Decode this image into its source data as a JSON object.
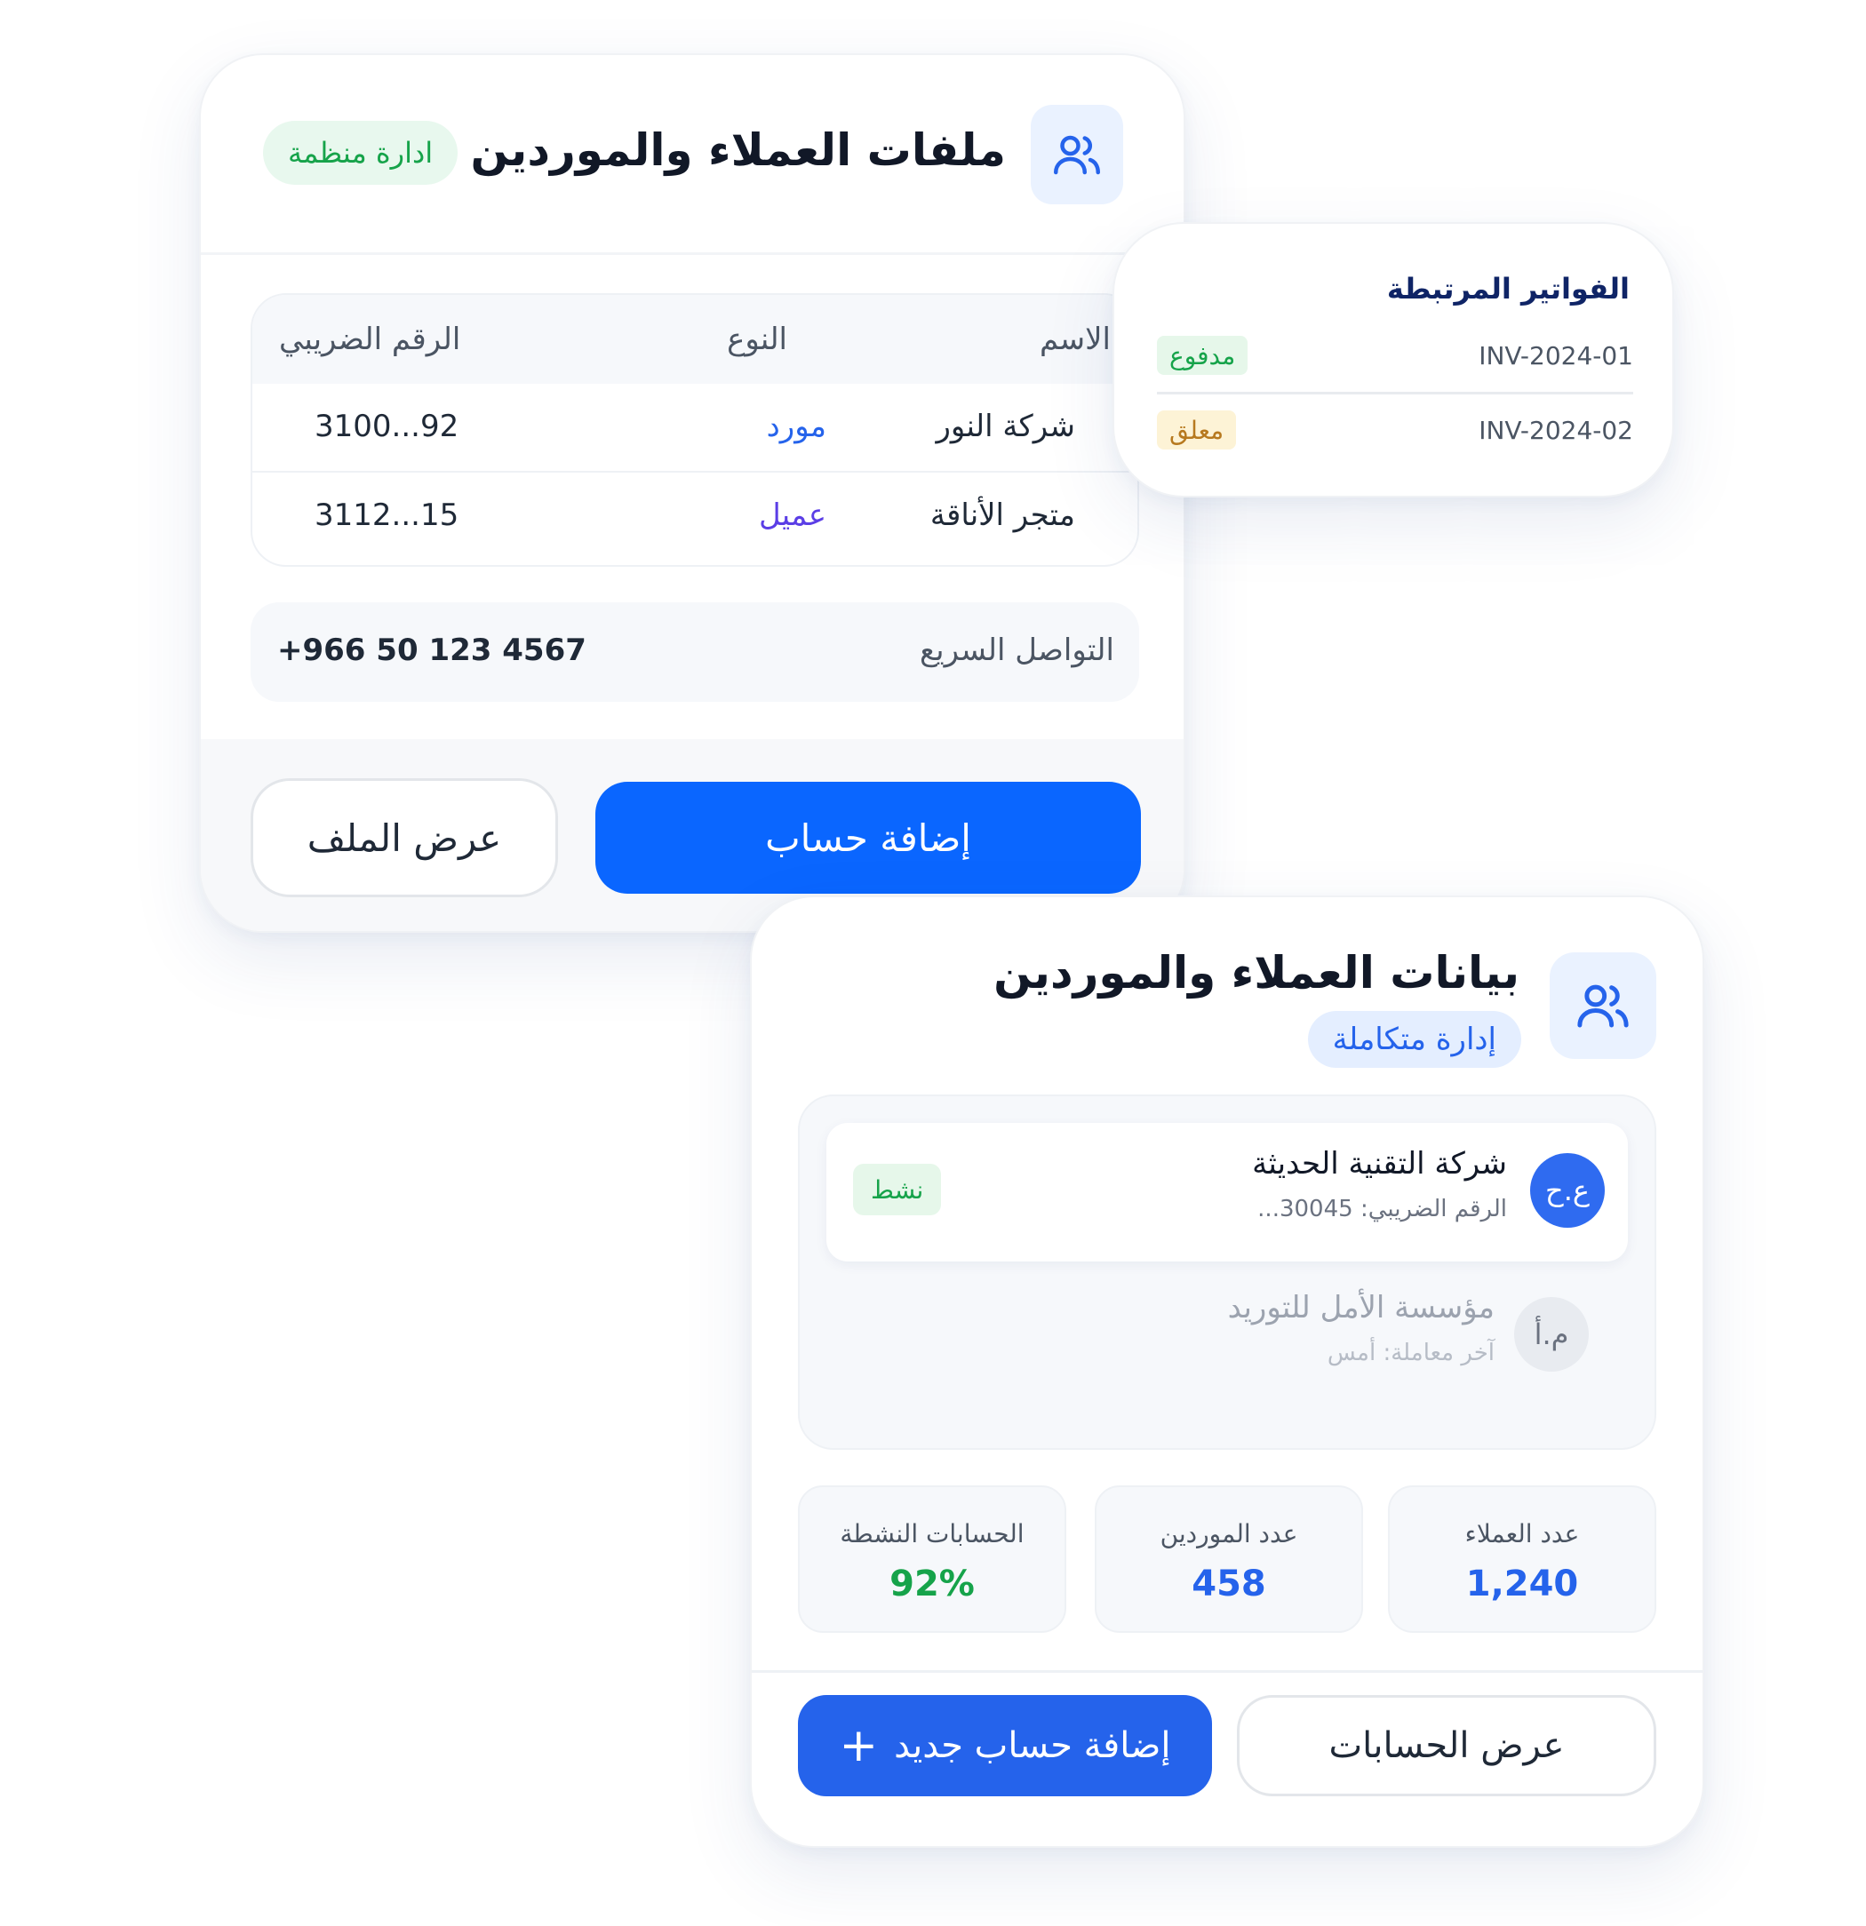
{
  "card1": {
    "title": "ملفات العملاء والموردين",
    "badge": "ادارة منظمة",
    "icon": "users-icon",
    "table": {
      "headers": {
        "name": "الاسم",
        "type": "النوع",
        "tax": "الرقم الضريبي"
      },
      "rows": [
        {
          "name": "شركة النور",
          "type": "مورد",
          "type_color": "#2563eb",
          "tax": "3100...92"
        },
        {
          "name": "متجر الأناقة",
          "type": "عميل",
          "type_color": "#5b3ee6",
          "tax": "3112...15"
        }
      ]
    },
    "contact": {
      "label": "التواصل السريع",
      "phone": "+966 50 123 4567"
    },
    "buttons": {
      "primary": "إضافة حساب",
      "secondary": "عرض الملف"
    }
  },
  "card2": {
    "title": "الفواتير المرتبطة",
    "invoices": [
      {
        "id": "INV-2024-01",
        "status": "مدفوع",
        "status_color": "#16a34a"
      },
      {
        "id": "INV-2024-02",
        "status": "معلق",
        "status_color": "#b7791f"
      }
    ]
  },
  "card3": {
    "title": "بيانات العملاء والموردين",
    "badge": "إدارة متكاملة",
    "icon": "users-icon",
    "accounts": [
      {
        "initials": "ع.ح",
        "name": "شركة التقنية الحديثة",
        "sub": "الرقم الضريبي: 30045...",
        "status": "نشط"
      },
      {
        "initials": "م.أ",
        "name": "مؤسسة الأمل للتوريد",
        "sub": "آخر معاملة: أمس"
      }
    ],
    "stats": [
      {
        "label": "عدد العملاء",
        "value": "1,240",
        "color": "#2563eb"
      },
      {
        "label": "عدد الموردين",
        "value": "458",
        "color": "#2563eb"
      },
      {
        "label": "الحسابات النشطة",
        "value": "92%",
        "color": "#16a34a"
      }
    ],
    "buttons": {
      "primary": "إضافة حساب جديد",
      "primary_icon": "plus-icon",
      "secondary": "عرض الحسابات"
    }
  },
  "colors": {
    "primary": "#0a66ff",
    "primary_dark": "#2563eb",
    "success": "#16a34a",
    "warning": "#b7791f"
  }
}
